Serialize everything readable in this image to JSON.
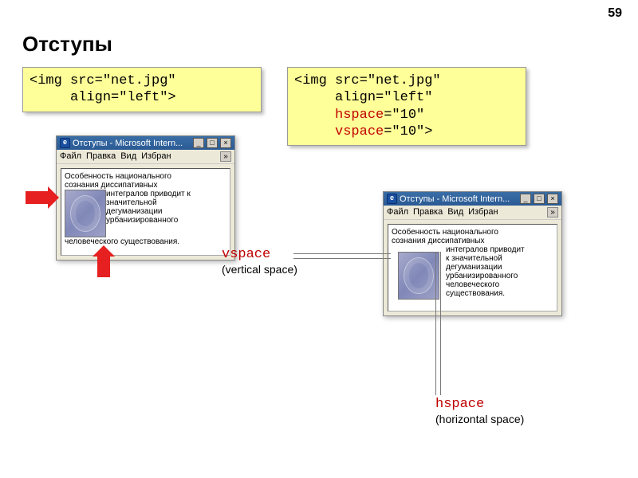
{
  "page_number": "59",
  "title": "Отступы",
  "code_left": {
    "l1": "<img src=\"net.jpg\"",
    "l2": "     align=\"left\">"
  },
  "code_right": {
    "l1": "<img src=\"net.jpg\"",
    "l2": "     align=\"left\"",
    "l3a": "     ",
    "l3b": "hspace",
    "l3c": "=\"10\"",
    "l4a": "     ",
    "l4b": "vspace",
    "l4c": "=\"10\">"
  },
  "browser": {
    "title": "Отступы - Microsoft Intern...",
    "menu": {
      "file": "Файл",
      "edit": "Правка",
      "view": "Вид",
      "fav": "Избран",
      "more": "»"
    },
    "win": {
      "min": "_",
      "max": "□",
      "close": "×"
    }
  },
  "text_left": {
    "pre": "Особенность национального\nсознания диссипативных",
    "wrap": "интегралов приводит к\nзначительной\nдегуманизации\nурбанизированного",
    "post": "человеческого существования."
  },
  "text_right": {
    "pre": "Особенность национального\nсознания диссипативных",
    "wrap": "интегралов приводит\nк значительной\nдегуманизации\nурбанизированного\nчеловеческого\nсуществования."
  },
  "labels": {
    "vspace_kw": "vspace",
    "vspace_sub": "(vertical space)",
    "hspace_kw": "hspace",
    "hspace_sub": "(horizontal space)"
  }
}
